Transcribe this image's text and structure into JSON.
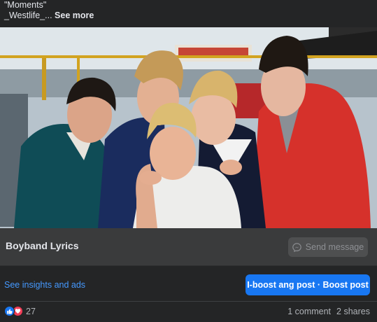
{
  "post": {
    "caption_line1": "\"Moments\"",
    "caption_line2": "_Westlife_...",
    "see_more": "See more"
  },
  "page": {
    "name": "Boyband Lyrics",
    "send_message": "Send message"
  },
  "actions": {
    "insights": "See insights and ads",
    "boost": "I-boost ang post · Boost post"
  },
  "stats": {
    "reaction_count": "27",
    "comments": "1 comment",
    "shares": "2 shares"
  },
  "colors": {
    "accent": "#1877f2",
    "link": "#4599ff",
    "like": "#1877f2",
    "love": "#f33e58"
  },
  "icons": [
    "messenger-icon",
    "like-reaction-icon",
    "love-reaction-icon"
  ]
}
